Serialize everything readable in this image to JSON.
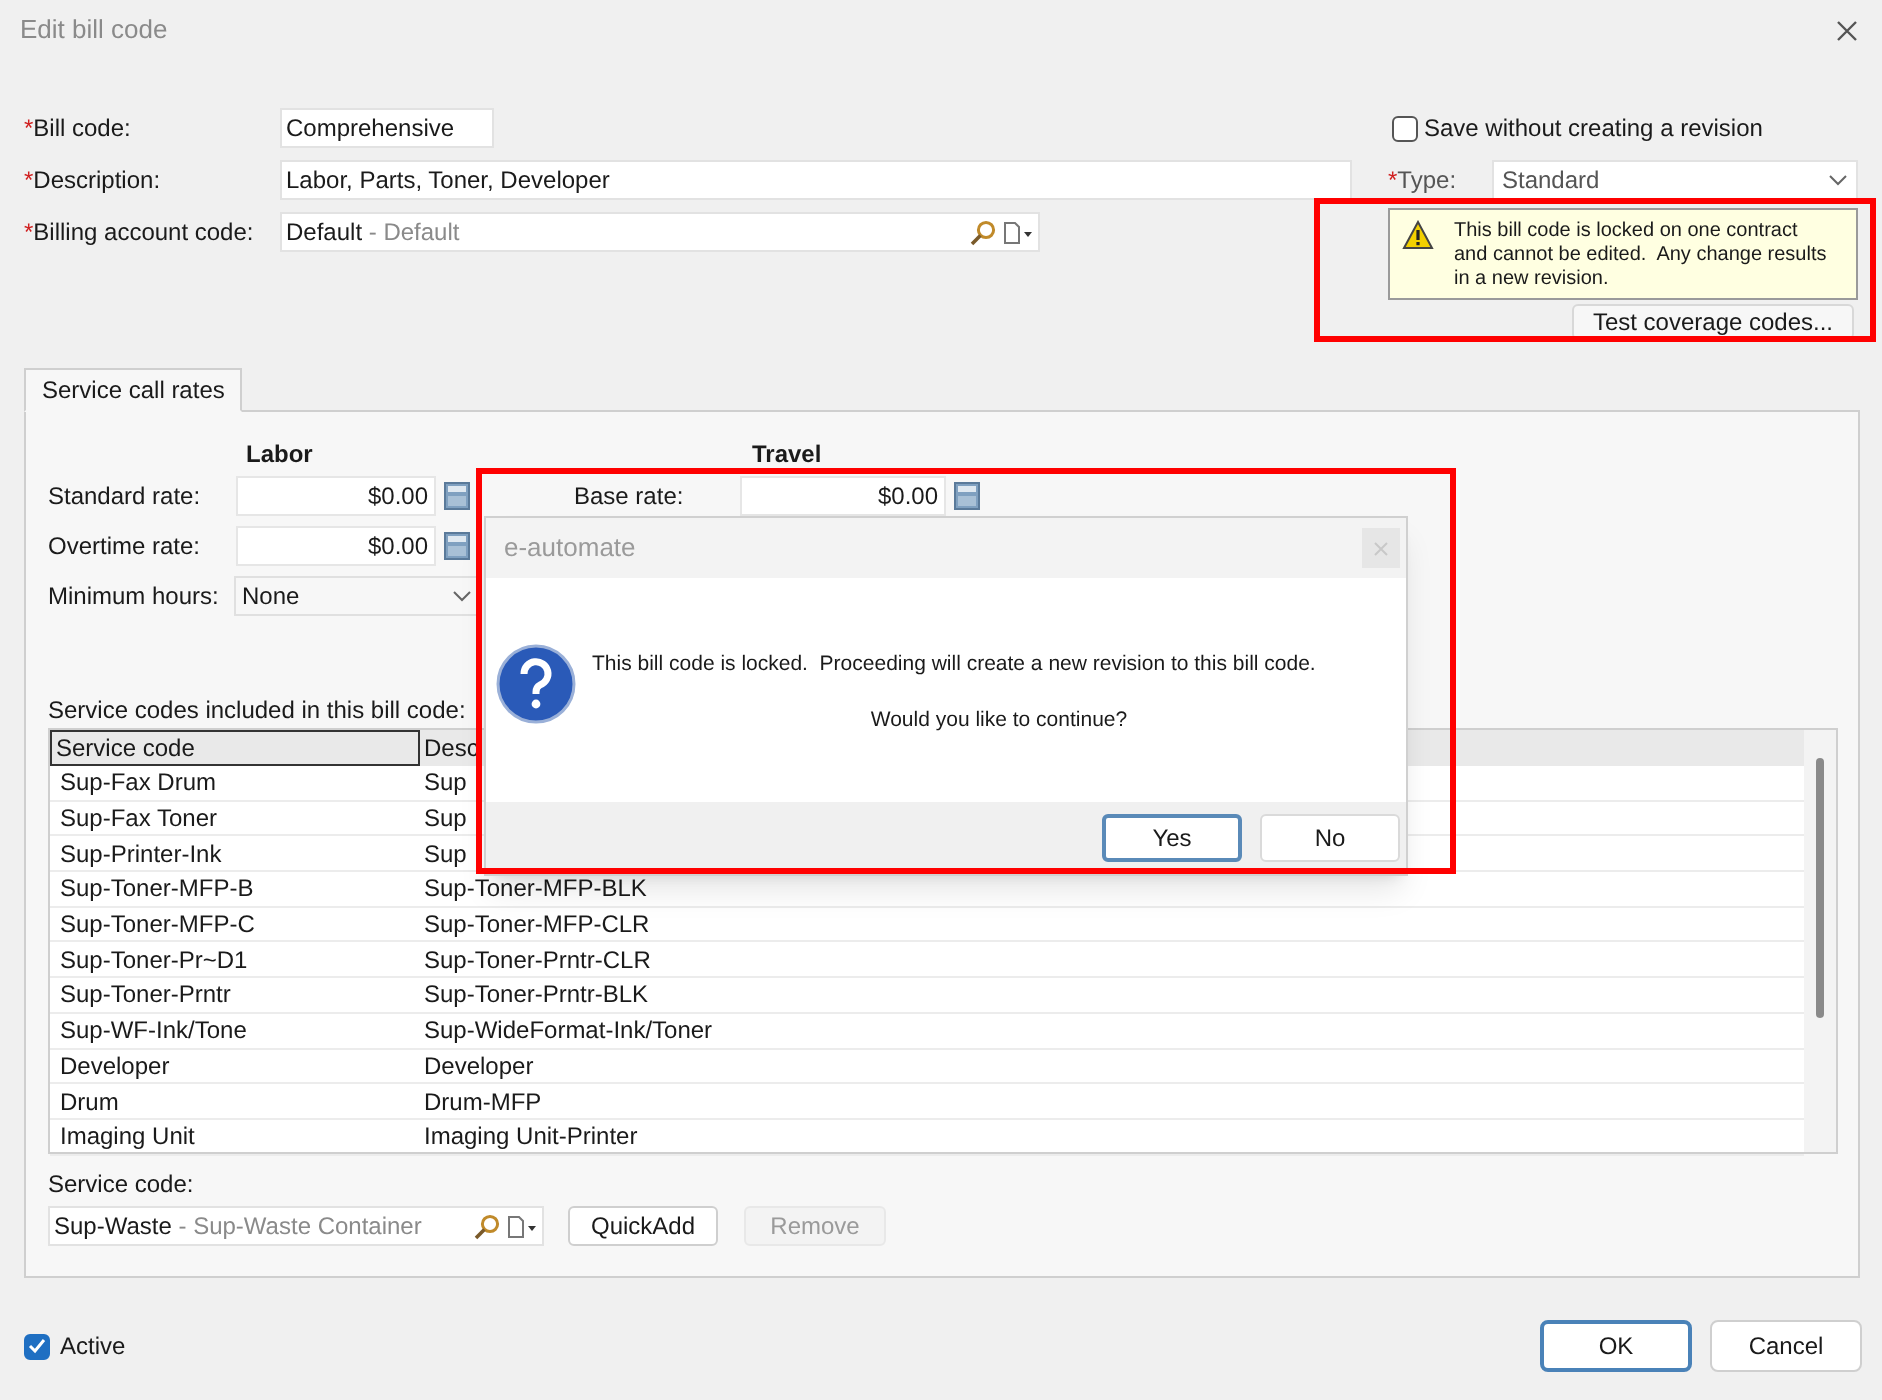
{
  "window": {
    "title": "Edit bill code"
  },
  "fields": [
    {
      "kind": "text",
      "mark": "*",
      "label": "Bill code:",
      "value": "Comprehensive"
    },
    {
      "kind": "text",
      "mark": "*",
      "label": "Description:",
      "value": "Labor, Parts, Toner, Developer"
    },
    {
      "kind": "lookup",
      "mark": "*",
      "label": "Billing account code:",
      "value": "Default",
      "detail": "- Default"
    }
  ],
  "save_without_revision": {
    "label": "Save without creating a revision",
    "checked": false
  },
  "type": {
    "mark": "*",
    "label": "Type:",
    "value": "Standard"
  },
  "warning": "This bill code is locked on one contract and cannot be edited.  Any change results in a new revision.",
  "test_coverage_button": "Test coverage codes...",
  "tabs": [
    {
      "label": "Service call rates",
      "selected": true
    }
  ],
  "rates": {
    "labor_heading": "Labor",
    "travel_heading": "Travel",
    "standard_rate": {
      "label": "Standard rate:",
      "value": "$0.00"
    },
    "overtime_rate": {
      "label": "Overtime rate:",
      "value": "$0.00"
    },
    "minimum_hours": {
      "label": "Minimum hours:",
      "value": "None"
    },
    "base_rate": {
      "label": "Base rate:",
      "value": "$0.00"
    }
  },
  "service_codes": {
    "caption": "Service codes included in this bill code:",
    "columns": [
      "Service code",
      "Desc"
    ],
    "rows": [
      [
        "Sup-Fax Drum",
        "Sup"
      ],
      [
        "Sup-Fax Toner",
        "Sup"
      ],
      [
        "Sup-Printer-Ink",
        "Sup"
      ],
      [
        "Sup-Toner-MFP-B",
        "Sup-Toner-MFP-BLK"
      ],
      [
        "Sup-Toner-MFP-C",
        "Sup-Toner-MFP-CLR"
      ],
      [
        "Sup-Toner-Pr~D1",
        "Sup-Toner-Prntr-CLR"
      ],
      [
        "Sup-Toner-Prntr",
        "Sup-Toner-Prntr-BLK"
      ],
      [
        "Sup-WF-Ink/Tone",
        "Sup-WideFormat-Ink/Toner"
      ],
      [
        "Developer",
        "Developer"
      ],
      [
        "Drum",
        "Drum-MFP"
      ],
      [
        "Imaging Unit",
        "Imaging Unit-Printer"
      ]
    ]
  },
  "service_code_field": {
    "label": "Service code:",
    "value": "Sup-Waste",
    "detail": "- Sup-Waste Container"
  },
  "quick_add": {
    "label": "QuickAdd",
    "disabled": false
  },
  "remove": {
    "label": "Remove",
    "disabled": true
  },
  "active": {
    "label": "Active",
    "checked": true
  },
  "buttons": [
    {
      "label": "OK",
      "default": true
    },
    {
      "label": "Cancel",
      "default": false
    }
  ],
  "message_box": {
    "title": "e-automate",
    "message": "This bill code is locked.  Proceeding will create a new revision to this bill code.",
    "question": "Would you like to continue?",
    "buttons": [
      {
        "label": "Yes",
        "default": true
      },
      {
        "label": "No",
        "default": false
      }
    ]
  }
}
